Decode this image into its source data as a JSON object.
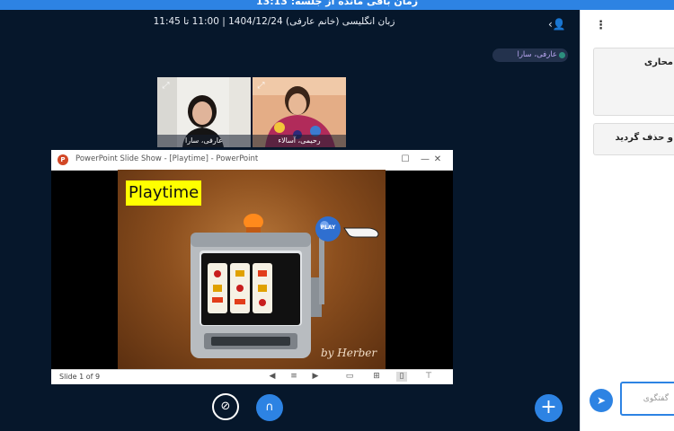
{
  "banner": {
    "text": "زمان باقی مانده از جلسه: 13:13"
  },
  "header": {
    "title": "زبان انگلیسی (خانم عارفی) 1404/12/24 | 11:00 تا 11:45",
    "user_icon": "user-icon"
  },
  "presenter": {
    "name": "عارفی، سارا"
  },
  "webcams": [
    {
      "name": "عارفی، سارا",
      "expand_icon": "expand-icon"
    },
    {
      "name": "رحیمی، آسالاء",
      "expand_icon": "expand-icon"
    }
  ],
  "ppt_window": {
    "title": "PowerPoint Slide Show - [Playtime] - PowerPoint",
    "minimize": "—",
    "restore": "☐",
    "close": "✕",
    "slide": {
      "heading": "Playtime",
      "play_label": "PLAY",
      "credit": "by Herber"
    },
    "status": {
      "slide_counter": "Slide 1 of 9"
    }
  },
  "controls": {
    "camera_icon": "camera-off-icon",
    "audio_icon": "headphones-icon",
    "plus_icon": "plus-icon"
  },
  "panel": {
    "menu_icon": "kebab-menu-icon",
    "card1_text": "محاری",
    "card2_text": "و حذف گردید",
    "chat_placeholder": "گفتگوی",
    "send_icon": "send-icon"
  },
  "colors": {
    "accent": "#2d83e3",
    "background": "#06172b",
    "slide_heading_bg": "#ffff00"
  }
}
